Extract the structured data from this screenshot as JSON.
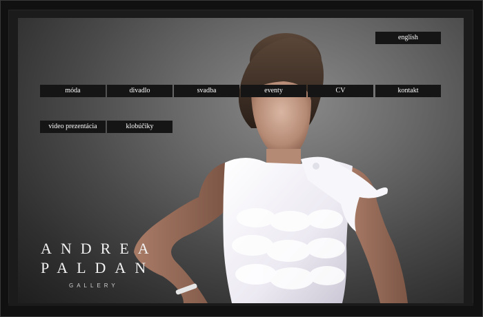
{
  "nav": {
    "language": "english",
    "row1": [
      "móda",
      "divadlo",
      "svadba",
      "eventy",
      "CV",
      "kontakt"
    ],
    "row2": [
      "video prezentácia",
      "klobúčiky"
    ]
  },
  "logo": {
    "line1": "ANDREA",
    "line2": "PALDAN",
    "line3": "GALLERY"
  },
  "colors": {
    "nav_bg": "#151515",
    "nav_text": "#ffffff",
    "background": "#0b0b0b"
  }
}
